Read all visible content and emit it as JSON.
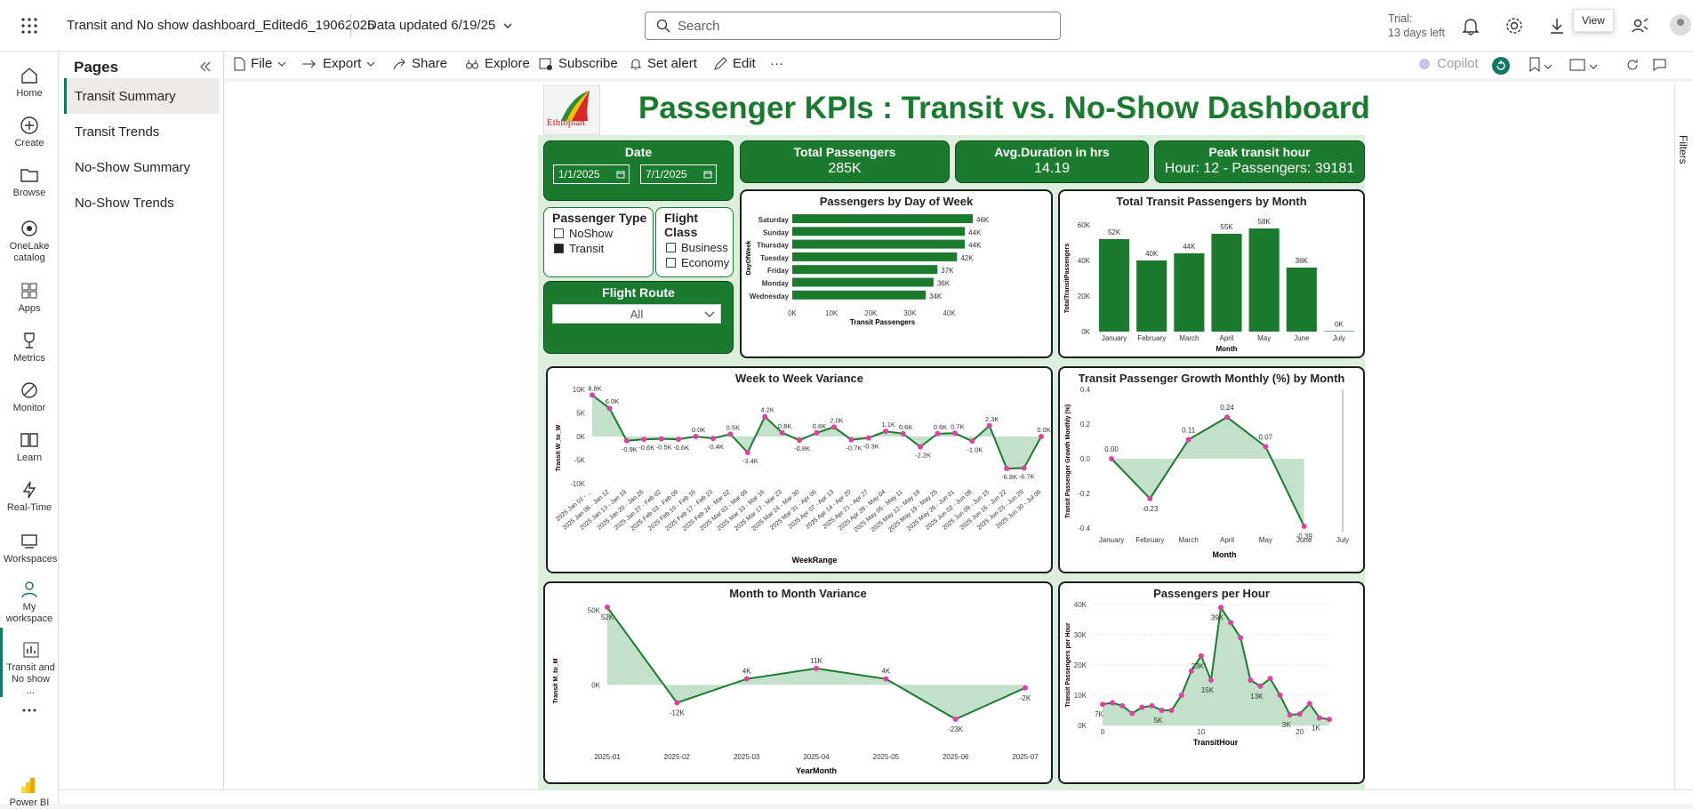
{
  "topbar": {
    "report_name": "Transit and No show dashboard_Edited6_19062025",
    "data_updated": "Data updated 6/19/25",
    "search_placeholder": "Search",
    "trial_line1": "Trial:",
    "trial_line2": "13 days left",
    "tooltip": "View"
  },
  "leftnav": [
    {
      "label": "Home",
      "icon": "home-icon"
    },
    {
      "label": "Create",
      "icon": "plus-icon"
    },
    {
      "label": "Browse",
      "icon": "folder-icon"
    },
    {
      "label": "OneLake catalog",
      "icon": "onelake-icon"
    },
    {
      "label": "Apps",
      "icon": "apps-icon"
    },
    {
      "label": "Metrics",
      "icon": "trophy-icon"
    },
    {
      "label": "Monitor",
      "icon": "monitor-icon"
    },
    {
      "label": "Learn",
      "icon": "book-icon"
    },
    {
      "label": "Real-Time",
      "icon": "lightning-icon"
    },
    {
      "label": "Workspaces",
      "icon": "workspaces-icon"
    },
    {
      "label": "My workspace",
      "icon": "person-icon"
    },
    {
      "label": "Transit and No show ...",
      "icon": "report-icon"
    },
    {
      "label": "...",
      "icon": "more-icon"
    },
    {
      "label": "Power BI",
      "icon": "powerbi-logo"
    }
  ],
  "pages": {
    "title": "Pages",
    "items": [
      "Transit Summary",
      "Transit Trends",
      "No-Show Summary",
      "No-Show Trends"
    ],
    "active": 0
  },
  "toolbar": {
    "file": "File",
    "export": "Export",
    "share": "Share",
    "explore": "Explore",
    "subscribe": "Subscribe",
    "set_alert": "Set alert",
    "edit": "Edit",
    "more": "···",
    "copilot": "Copilot"
  },
  "report": {
    "logo_text": "Ethiopian",
    "title": "Passenger KPIs : Transit vs. No-Show Dashboard",
    "date": {
      "label": "Date",
      "start": "1/1/2025",
      "end": "7/1/2025"
    },
    "kpis": [
      {
        "title": "Total Passengers",
        "value": "285K"
      },
      {
        "title": "Avg.Duration in hrs",
        "value": "14.19"
      },
      {
        "title": "Peak transit hour",
        "value": "Hour: 12 - Passengers: 39181"
      }
    ],
    "passenger_type": {
      "title": "Passenger Type",
      "options": [
        {
          "label": "NoShow",
          "checked": false
        },
        {
          "label": "Transit",
          "checked": true
        }
      ]
    },
    "flight_class": {
      "title": "Flight Class",
      "options": [
        {
          "label": "Business",
          "checked": false
        },
        {
          "label": "Economy",
          "checked": false
        }
      ]
    },
    "flight_route": {
      "title": "Flight Route",
      "value": "All"
    }
  },
  "chart_data": [
    {
      "id": "day_of_week",
      "type": "bar",
      "orientation": "horizontal",
      "title": "Passengers by Day of Week",
      "xlabel": "Transit Passengers",
      "ylabel": "DayOfWeek",
      "categories": [
        "Saturday",
        "Sunday",
        "Thursday",
        "Tuesday",
        "Friday",
        "Monday",
        "Wednesday"
      ],
      "values": [
        46,
        44,
        44,
        42,
        37,
        36,
        34
      ],
      "labels": [
        "46K",
        "44K",
        "44K",
        "42K",
        "37K",
        "36K",
        "34K"
      ],
      "xlim": [
        0,
        46
      ],
      "ticks": [
        0,
        10,
        20,
        30,
        40
      ],
      "tick_labels": [
        "0K",
        "10K",
        "20K",
        "30K",
        "40K"
      ],
      "color": "#1a7a2e"
    },
    {
      "id": "by_month",
      "type": "bar",
      "title": "Total Transit Passengers by Month",
      "xlabel": "Month",
      "ylabel": "TotalTransitPassengers",
      "categories": [
        "January",
        "February",
        "March",
        "April",
        "May",
        "June",
        "July"
      ],
      "values": [
        52,
        40,
        44,
        55,
        58,
        36,
        0.3
      ],
      "labels": [
        "52K",
        "40K",
        "44K",
        "55K",
        "58K",
        "36K",
        "0K"
      ],
      "ylim": [
        0,
        60
      ],
      "ticks": [
        0,
        20,
        40,
        60
      ],
      "tick_labels": [
        "0K",
        "20K",
        "40K",
        "60K"
      ],
      "color": "#1a7a2e"
    },
    {
      "id": "week_variance",
      "type": "area",
      "title": "Week to Week Variance",
      "xlabel": "WeekRange",
      "ylabel": "Transit W_to_W",
      "categories": [
        "2025 Jan 01 - ...",
        "2025 Jan 06 - Jan 12",
        "2025 Jan 13 - Jan 19",
        "2025 Jan 20 - Jan 26",
        "2025 Jan 27 - Feb 02",
        "2025 Feb 03 - Feb 09",
        "2025 Feb 10 - Feb 16",
        "2025 Feb 17 - Feb 23",
        "2025 Feb 24 - Mar 02",
        "2025 Mar 03 - Mar 09",
        "2025 Mar 10 - Mar 16",
        "2025 Mar 17 - Mar 23",
        "2025 Mar 24 - Mar 30",
        "2025 Mar 31 - Apr 06",
        "2025 Apr 07 - Apr 13",
        "2025 Apr 14 - Apr 20",
        "2025 Apr 21 - Apr 27",
        "2025 Apr 28 - May 04",
        "2025 May 05 - May 11",
        "2025 May 12 - May 18",
        "2025 May 19 - May 25",
        "2025 May 26 - Jun 01",
        "2025 Jun 02 - Jun 08",
        "2025 Jun 09 - Jun 15",
        "2025 Jun 16 - Jun 22",
        "2025 Jun 23 - Jun 29",
        "2025 Jun 30 - Jul 06"
      ],
      "values": [
        8.8,
        6.0,
        -0.9,
        -0.6,
        -0.5,
        -0.6,
        0.0,
        -0.4,
        0.5,
        -3.4,
        4.2,
        0.8,
        -0.8,
        0.8,
        2.0,
        -0.7,
        -0.3,
        1.1,
        0.6,
        -2.2,
        0.6,
        0.7,
        -1.0,
        2.3,
        -6.8,
        -6.7,
        0.0
      ],
      "labels": [
        "8.8K",
        "6.0K",
        "-0.9K",
        "-0.6K",
        "-0.5K",
        "-0.6K",
        "0.0K",
        "-0.4K",
        "0.5K",
        "-3.4K",
        "4.2K",
        "0.8K",
        "-0.8K",
        "0.8K",
        "2.0K",
        "-0.7K",
        "-0.3K",
        "1.1K",
        "0.6K",
        "-2.2K",
        "0.6K",
        "0.7K",
        "-1.0K",
        "2.3K",
        "-6.8K",
        "-6.7K",
        "0.0K"
      ],
      "ylim": [
        -10,
        10
      ],
      "ticks": [
        -10,
        -5,
        0,
        5,
        10
      ],
      "tick_labels": [
        "-10K",
        "-5K",
        "0K",
        "5K",
        "10K"
      ],
      "color": "#1a7a2e",
      "marker_color": "#e040a0"
    },
    {
      "id": "growth",
      "type": "area",
      "title": "Transit Passenger Growth Monthly (%) by Month",
      "xlabel": "Month",
      "ylabel": "Transit Passenger Growth Monthly (%)",
      "categories": [
        "January",
        "February",
        "March",
        "April",
        "May",
        "June",
        "July"
      ],
      "values": [
        0.0,
        -0.23,
        0.11,
        0.24,
        0.07,
        -0.39,
        null
      ],
      "labels": [
        "0.00",
        "-0.23",
        "0.11",
        "0.24",
        "0.07",
        "-0.39",
        ""
      ],
      "ylim": [
        -0.4,
        0.4
      ],
      "ticks": [
        -0.4,
        -0.2,
        0.0,
        0.2,
        0.4
      ],
      "tick_labels": [
        "-0.4",
        "-0.2",
        "0.0",
        "0.2",
        "0.4"
      ],
      "color": "#1a7a2e",
      "marker_color": "#e040a0"
    },
    {
      "id": "month_variance",
      "type": "area",
      "title": "Month to Month Variance",
      "xlabel": "YearMonth",
      "ylabel": "Transit M_to_M",
      "categories": [
        "2025-01",
        "2025-02",
        "2025-03",
        "2025-04",
        "2025-05",
        "2025-06",
        "2025-07"
      ],
      "values": [
        52,
        -12,
        4,
        11,
        4,
        -23,
        -2
      ],
      "labels": [
        "52K",
        "-12K",
        "4K",
        "11K",
        "4K",
        "-23K",
        "-2K"
      ],
      "ylim": [
        -45,
        55
      ],
      "ticks": [
        0,
        50
      ],
      "tick_labels": [
        "0K",
        "50K"
      ],
      "color": "#1a7a2e",
      "marker_color": "#e040a0"
    },
    {
      "id": "per_hour",
      "type": "area",
      "title": "Passengers per Hour",
      "xlabel": "TransitHour",
      "ylabel": "Transit Passengers per Hour",
      "x": [
        0,
        1,
        2,
        3,
        4,
        5,
        6,
        7,
        8,
        9,
        10,
        11,
        12,
        13,
        14,
        15,
        16,
        17,
        18,
        19,
        20,
        21,
        22,
        23
      ],
      "values": [
        7,
        7.5,
        6.5,
        4,
        6,
        6.5,
        5,
        5,
        10,
        18,
        23,
        15,
        39,
        34,
        29,
        15,
        13,
        15.5,
        10,
        3.5,
        3.8,
        7.2,
        2.5,
        2
      ],
      "point_labels": {
        "0": "7K",
        "6": "5K",
        "10": "23K",
        "11": "15K",
        "12": "39K",
        "16": "13K",
        "19": "3K",
        "22": "1K"
      },
      "xlim": [
        0,
        23
      ],
      "ylim": [
        0,
        40
      ],
      "ticks": [
        0,
        10,
        20,
        30,
        40
      ],
      "tick_labels": [
        "0K",
        "10K",
        "20K",
        "30K",
        "40K"
      ],
      "xticks": [
        0,
        10,
        20
      ],
      "color": "#1a7a2e",
      "marker_color": "#e040a0"
    }
  ]
}
